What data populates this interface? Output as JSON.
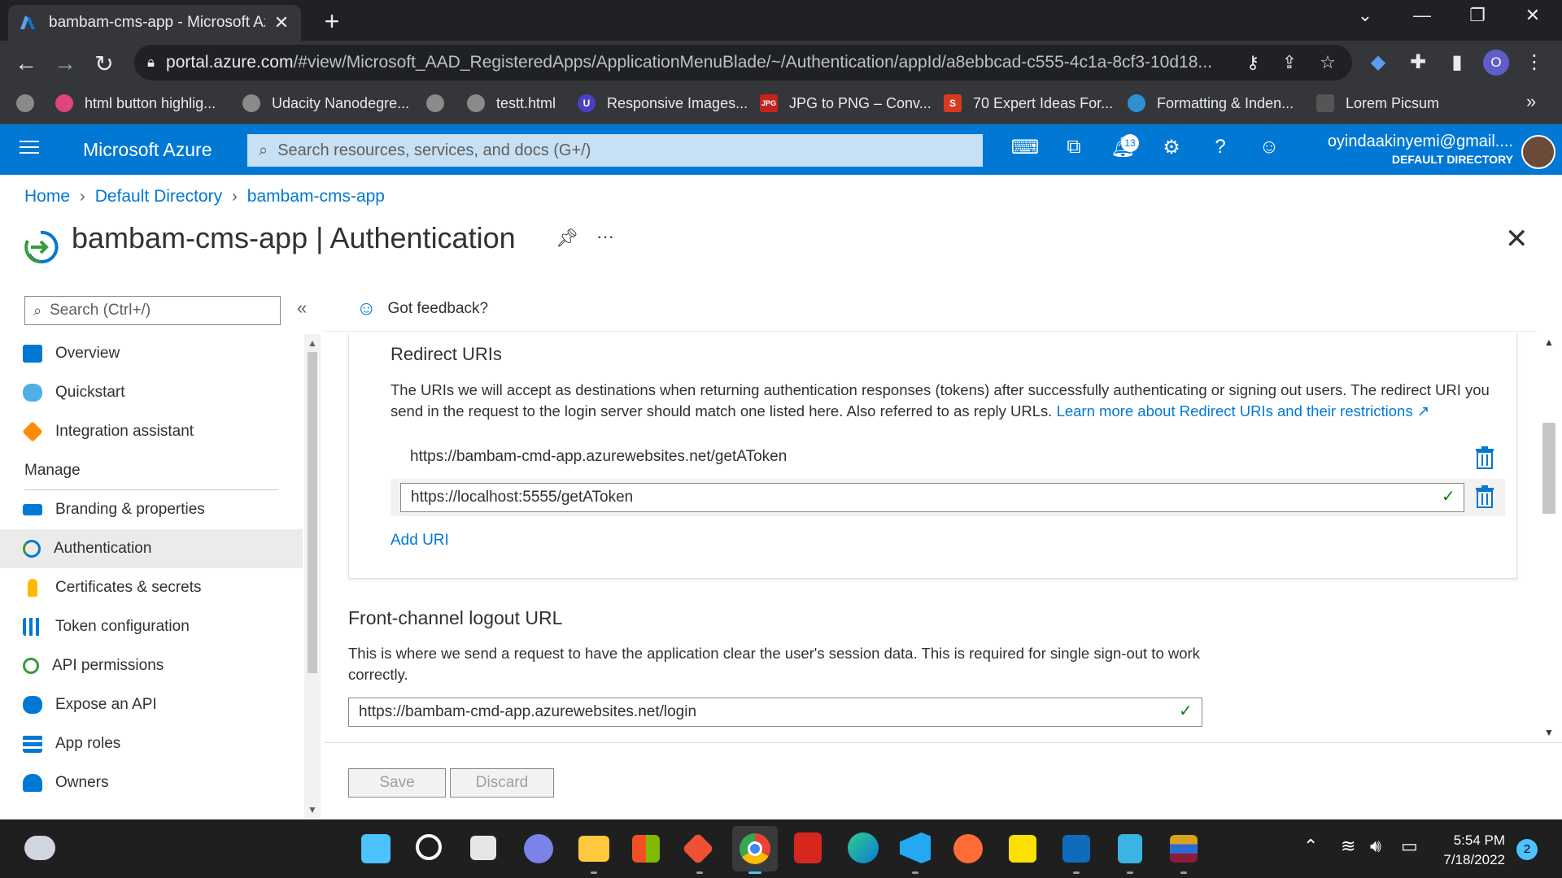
{
  "browser": {
    "tab_title": "bambam-cms-app - Microsoft Az",
    "tab_close": "✕",
    "new_tab": "+",
    "url_host": "portal.azure.com",
    "url_path": "/#view/Microsoft_AAD_RegisteredApps/ApplicationMenuBlade/~/Authentication/appId/a8ebbcad-c555-4c1a-8cf3-10d18...",
    "profile_initial": "O",
    "bookmarks": [
      {
        "label": "html button highlig...",
        "icon": "sparkle-icon",
        "color": "#e0447b"
      },
      {
        "label": "Udacity Nanodegre...",
        "icon": "globe-icon",
        "color": "#8a8a8a"
      },
      {
        "label": "",
        "icon": "globe-icon",
        "color": "#8a8a8a"
      },
      {
        "label": "testt.html",
        "icon": "globe-icon",
        "color": "#8a8a8a"
      },
      {
        "label": "Responsive Images...",
        "icon": "u-logo-icon",
        "color": "#4b3fc8"
      },
      {
        "label": "JPG to PNG – Conv...",
        "icon": "jpg-png-icon",
        "color": "#c4231d"
      },
      {
        "label": "70 Expert Ideas For...",
        "icon": "s-logo-icon",
        "color": "#d63a1f"
      },
      {
        "label": "Formatting & Inden...",
        "icon": "earth-icon",
        "color": "#2f8fd0"
      },
      {
        "label": "Lorem Picsum",
        "icon": "camera-icon",
        "color": "#555555"
      }
    ],
    "bookmarks_overflow": "»"
  },
  "azure": {
    "brand": "Microsoft Azure",
    "search_placeholder": "Search resources, services, and docs (G+/)",
    "notification_count": "13",
    "account_email": "oyindaakinyemi@gmail....",
    "account_directory": "DEFAULT DIRECTORY"
  },
  "breadcrumb": [
    "Home",
    "Default Directory",
    "bambam-cms-app"
  ],
  "page": {
    "title": "bambam-cms-app | Authentication",
    "more": "···",
    "close": "✕"
  },
  "nav": {
    "search_placeholder": "Search (Ctrl+/)",
    "collapse": "«",
    "items": [
      {
        "label": "Overview",
        "icon": "overview-icon",
        "color": "#0078d4"
      },
      {
        "label": "Quickstart",
        "icon": "cloud-icon",
        "color": "#50e6ff"
      },
      {
        "label": "Integration assistant",
        "icon": "rocket-icon",
        "color": "#ff8c00"
      }
    ],
    "group_label": "Manage",
    "manage_items": [
      {
        "label": "Branding & properties",
        "icon": "branding-icon",
        "color": "#0078d4"
      },
      {
        "label": "Authentication",
        "icon": "authentication-icon",
        "color": "#0078d4"
      },
      {
        "label": "Certificates & secrets",
        "icon": "key-icon",
        "color": "#ffb900"
      },
      {
        "label": "Token configuration",
        "icon": "token-icon",
        "color": "#0078d4"
      },
      {
        "label": "API permissions",
        "icon": "api-permissions-icon",
        "color": "#3a9a3a"
      },
      {
        "label": "Expose an API",
        "icon": "expose-api-icon",
        "color": "#0078d4"
      },
      {
        "label": "App roles",
        "icon": "app-roles-icon",
        "color": "#0078d4"
      },
      {
        "label": "Owners",
        "icon": "owners-icon",
        "color": "#0078d4"
      }
    ],
    "active_item": "Authentication"
  },
  "main": {
    "feedback": "Got feedback?",
    "redirect": {
      "title": "Redirect URIs",
      "description": "The URIs we will accept as destinations when returning authentication responses (tokens) after successfully authenticating or signing out users. The redirect URI you send in the request to the login server should match one listed here. Also referred to as reply URLs.",
      "learn_more": "Learn more about Redirect URIs and their restrictions",
      "uris": [
        "https://bambam-cmd-app.azurewebsites.net/getAToken",
        "https://localhost:5555/getAToken"
      ],
      "add_uri": "Add URI"
    },
    "front_channel": {
      "title": "Front-channel logout URL",
      "description": "This is where we send a request to have the application clear the user's session data. This is required for single sign-out to work correctly.",
      "value": "https://bambam-cmd-app.azurewebsites.net/login"
    },
    "save": "Save",
    "discard": "Discard"
  },
  "taskbar": {
    "time": "5:54 PM",
    "date": "7/18/2022",
    "notifications": "2"
  }
}
